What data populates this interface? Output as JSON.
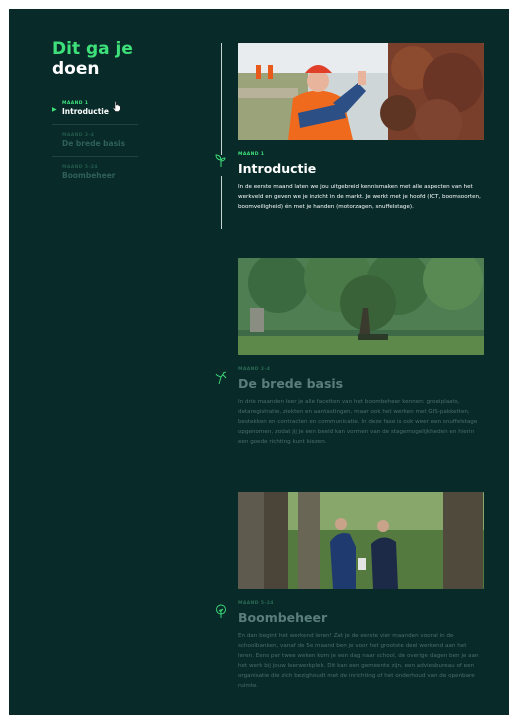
{
  "header": {
    "title_line1": "Dit ga je",
    "title_line2": "doen"
  },
  "nav": {
    "items": [
      {
        "kicker": "MAAND 1",
        "label": "Introductie"
      },
      {
        "kicker": "MAAND 2-4",
        "label": "De brede basis"
      },
      {
        "kicker": "MAAND 5-24",
        "label": "Boombeheer"
      }
    ]
  },
  "sections": [
    {
      "kicker": "MAAND 1",
      "title": "Introductie",
      "body": "In de eerste maand laten we jou uitgebreid kennismaken met alle aspecten van het werkveld en geven we je inzicht in de markt. Je werkt met je hoofd (ICT, boomsoorten, boomveiligheid) én met je handen (motorzagen, snuffelstage)."
    },
    {
      "kicker": "MAAND 2-4",
      "title": "De brede basis",
      "body": "In drie maanden leer je alle facetten van het boombeheer kennen: groeiplaats, dataregistratie, ziekten en aantastingen, maar ook het werken met GIS-pakketten, bestekken en contracten en communicatie. In deze fase is ook weer een snuffelstage opgenomen, zodat jij je een beeld kan vormen van de stagemogelijkheden en hierin een goede richting kunt kiezen."
    },
    {
      "kicker": "MAAND 5-24",
      "title": "Boombeheer",
      "body": "En dan begint het werkend leren! Zat je de eerste vier maanden vooral in de schoolbanken, vanaf de 5e maand ben je voor het grootste deel werkend aan het leren. Eens per twee weken kom je een dag naar school, de overige dagen ben je aan het werk bij jouw leerwerkplek. Dit kan een gemeente zijn, een adviesbureau of een organisatie die zich bezighoudt met de inrichting of het onderhoud van de openbare ruimte."
    }
  ],
  "colors": {
    "background": "#082b2a",
    "accent": "#3ee07a"
  },
  "icons": [
    "sprout-icon",
    "seedling-icon",
    "tree-icon",
    "pointer-cursor-icon",
    "arrow-right-icon"
  ]
}
